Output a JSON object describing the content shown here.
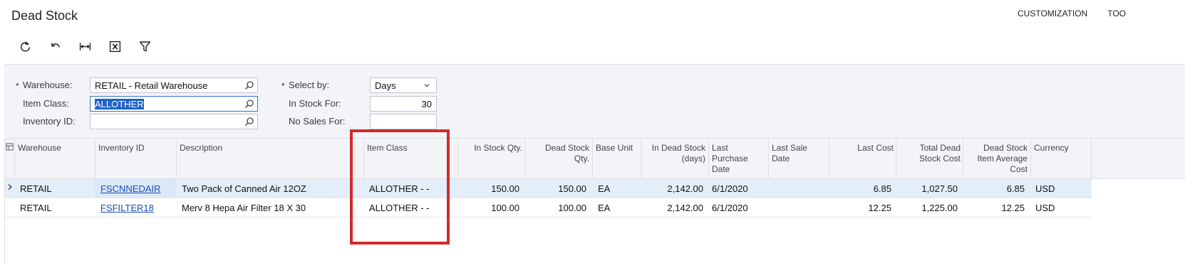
{
  "page": {
    "title": "Dead Stock",
    "top_menu": [
      "CUSTOMIZATION",
      "TOO"
    ]
  },
  "toolbar": {
    "buttons": [
      "refresh-icon",
      "undo-icon",
      "fit-columns-icon",
      "export-excel-icon",
      "filter-icon"
    ]
  },
  "filters": {
    "warehouse_label": "Warehouse:",
    "warehouse_value": "RETAIL - Retail Warehouse",
    "item_class_label": "Item Class:",
    "item_class_value": "ALLOTHER",
    "inventory_id_label": "Inventory ID:",
    "inventory_id_value": "",
    "select_by_label": "Select by:",
    "select_by_value": "Days",
    "in_stock_for_label": "In Stock For:",
    "in_stock_for_value": "30",
    "no_sales_for_label": "No Sales For:",
    "no_sales_for_value": "",
    "required_mark": "*"
  },
  "grid": {
    "columns": {
      "warehouse": "Warehouse",
      "inventory_id": "Inventory ID",
      "description": "Description",
      "item_class": "Item Class",
      "in_stock_qty": "In Stock Qty.",
      "dead_stock_qty": "Dead Stock Qty.",
      "base_unit": "Base Unit",
      "in_dead_stock_days": "In Dead Stock (days)",
      "last_purchase_date": "Last Purchase Date",
      "last_sale_date": "Last Sale Date",
      "last_cost": "Last Cost",
      "total_dead_stock_cost": "Total Dead Stock Cost",
      "dead_stock_item_avg_cost": "Dead Stock Item Average Cost",
      "currency": "Currency"
    },
    "rows": [
      {
        "warehouse": "RETAIL",
        "inventory_id": "FSCNNEDAIR",
        "description": "Two Pack of Canned Air 12OZ",
        "item_class": "ALLOTHER - -",
        "in_stock_qty": "150.00",
        "dead_stock_qty": "150.00",
        "base_unit": "EA",
        "in_dead_stock_days": "2,142.00",
        "last_purchase_date": "6/1/2020",
        "last_sale_date": "",
        "last_cost": "6.85",
        "total_dead_stock_cost": "1,027.50",
        "dead_stock_item_avg_cost": "6.85",
        "currency": "USD"
      },
      {
        "warehouse": "RETAIL",
        "inventory_id": "FSFILTER18",
        "description": "Merv 8 Hepa Air Filter 18 X 30",
        "item_class": "ALLOTHER - -",
        "in_stock_qty": "100.00",
        "dead_stock_qty": "100.00",
        "base_unit": "EA",
        "in_dead_stock_days": "2,142.00",
        "last_purchase_date": "6/1/2020",
        "last_sale_date": "",
        "last_cost": "12.25",
        "total_dead_stock_cost": "1,225.00",
        "dead_stock_item_avg_cost": "12.25",
        "currency": "USD"
      }
    ]
  },
  "colors": {
    "highlight_box": "#d32a2a",
    "link": "#1a4fb5",
    "selected_row": "#e3eef9"
  }
}
